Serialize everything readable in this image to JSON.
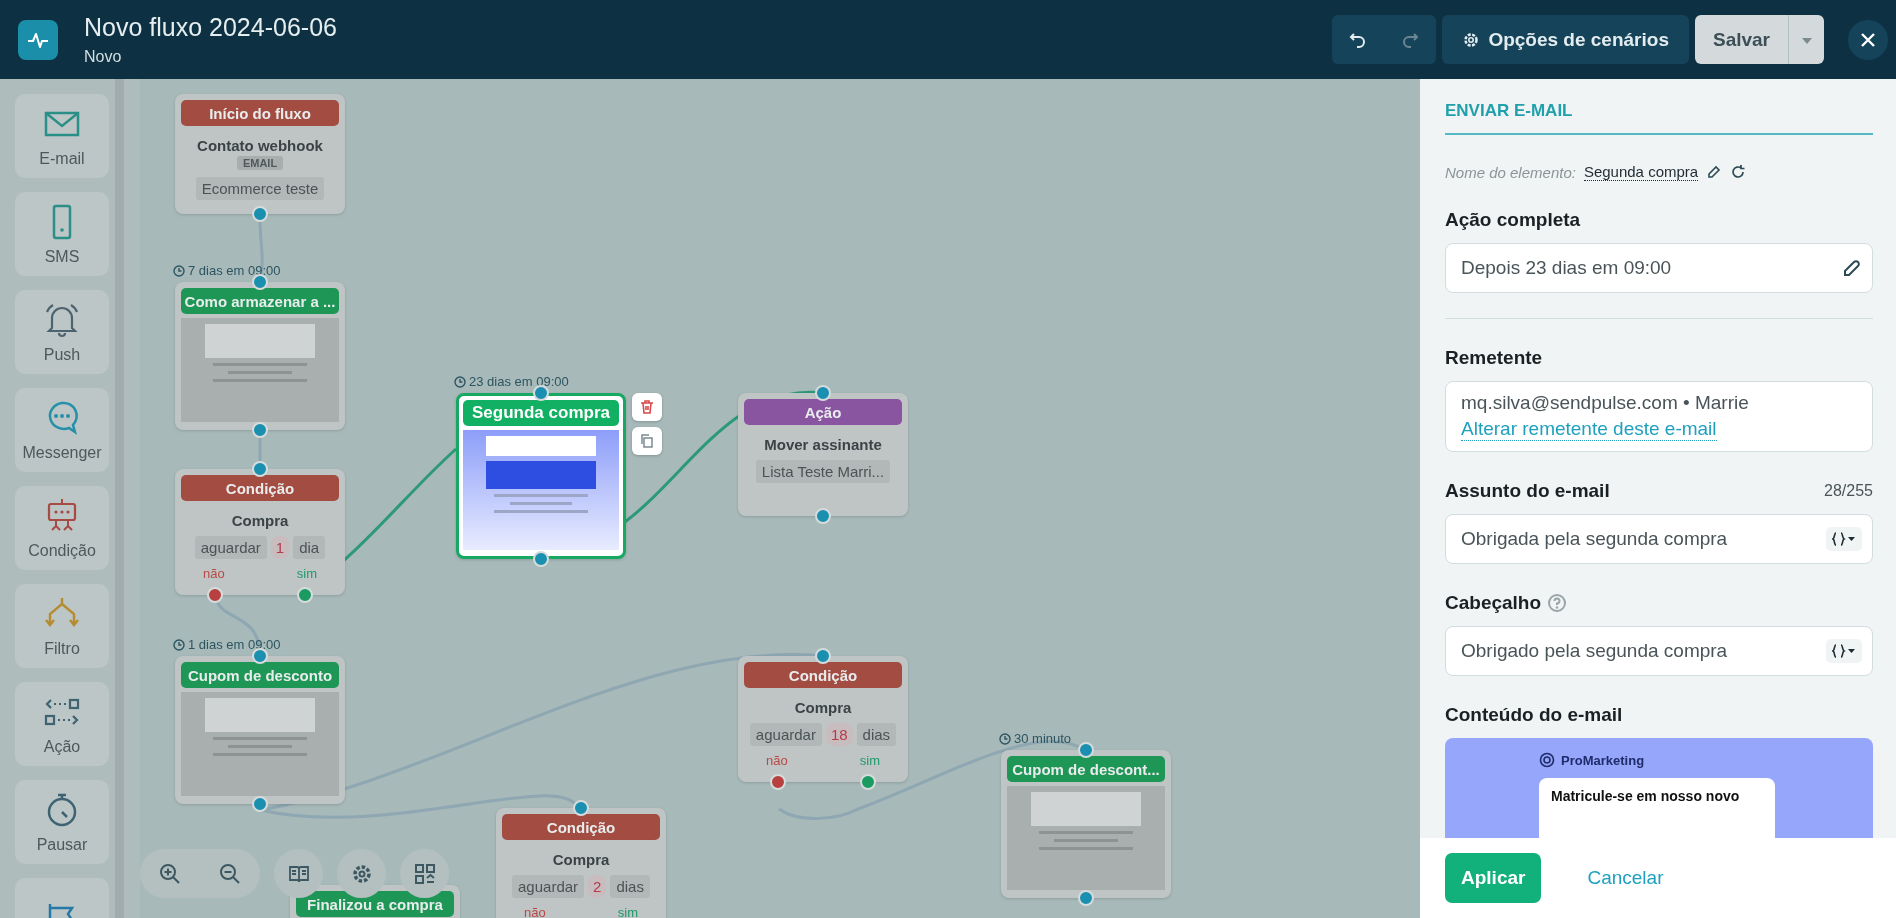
{
  "header": {
    "title": "Novo fluxo 2024-06-06",
    "subtitle": "Novo",
    "history": [
      {
        "kind": "undo",
        "disabled": false
      },
      {
        "kind": "redo",
        "disabled": true
      }
    ],
    "settings_button": "Opções de cenários",
    "save_button": "Salvar"
  },
  "palette": [
    {
      "kind": "email",
      "label": "E-mail"
    },
    {
      "kind": "sms",
      "label": "SMS"
    },
    {
      "kind": "push",
      "label": "Push"
    },
    {
      "kind": "messenger",
      "label": "Messenger"
    },
    {
      "kind": "condition",
      "label": "Condição"
    },
    {
      "kind": "filter",
      "label": "Filtro"
    },
    {
      "kind": "action",
      "label": "Ação"
    },
    {
      "kind": "pause",
      "label": "Pausar"
    },
    {
      "kind": "goal"
    }
  ],
  "canvas": {
    "nodes": [
      {
        "kind": "start",
        "header": "Início do fluxo",
        "title": "Contato webhook",
        "tag": "EMAIL",
        "chip": "Ecommerce teste"
      },
      {
        "kind": "email",
        "header": "Como armazenar a ...",
        "timer": "7 dias em 09:00",
        "selected": false
      },
      {
        "kind": "condition",
        "header": "Condição",
        "title": "Compra",
        "wait": "aguardar",
        "count": "1",
        "unit": "dia",
        "no": "não",
        "yes": "sim"
      },
      {
        "kind": "email",
        "header": "Cupom de desconto",
        "timer": "1 dias em 09:00",
        "selected": false
      },
      {
        "kind": "email",
        "header": "Segunda compra",
        "timer": "23 dias em 09:00",
        "selected": true
      },
      {
        "kind": "action",
        "header": "Ação",
        "title": "Mover assinante",
        "chip": "Lista Teste Marri..."
      },
      {
        "kind": "condition",
        "header": "Condição",
        "title": "Compra",
        "wait": "aguardar",
        "count": "18",
        "unit": "dias",
        "no": "não",
        "yes": "sim"
      },
      {
        "kind": "condition",
        "header": "Condição",
        "title": "Compra",
        "wait": "aguardar",
        "count": "2",
        "unit": "dias",
        "no": "não",
        "yes": "sim"
      },
      {
        "kind": "email",
        "header": "Cupom de descont...",
        "timer": "30 minuto",
        "selected": false
      },
      {
        "kind": "email",
        "header": "Finalizou a compra",
        "selected": false
      }
    ]
  },
  "panel": {
    "heading": "ENVIAR E-MAIL",
    "name_label": "Nome do elemento:",
    "name_value": "Segunda compra",
    "action_label": "Ação completa",
    "action_value": "Depois 23 dias em 09:00",
    "sender_label": "Remetente",
    "sender_value": "mq.silva@sendpulse.com • Marrie",
    "sender_link": "Alterar remetente deste e-mail",
    "subject_label": "Assunto do e-mail",
    "subject_count": "28/255",
    "subject_value": "Obrigada pela segunda compra",
    "preheader_label": "Cabeçalho",
    "preheader_value": "Obrigado pela segunda compra",
    "content_label": "Conteúdo do e-mail",
    "preview_brand": "ProMarketing",
    "preview_headline": "Matricule-se em nosso novo",
    "apply_button": "Aplicar",
    "cancel_button": "Cancelar"
  }
}
